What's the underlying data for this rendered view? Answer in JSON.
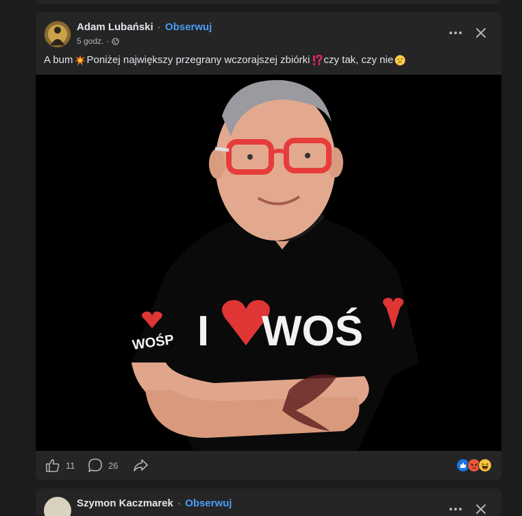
{
  "post": {
    "author": "Adam Lubański",
    "separator": "·",
    "follow_label": "Obserwuj",
    "time": "5 godz.",
    "meta_separator": "·",
    "text_part1": "A bum",
    "text_part2": "Poniżej największy przegrany wczorajszej zbiórki",
    "text_part3": "czy tak, czy nie",
    "emoji_1": "collision-emoji",
    "emoji_2": "exclamation-question-emoji",
    "emoji_3": "thinking-face-emoji",
    "image": {
      "shirt_text_left": "I",
      "shirt_text_right": "WOŚ",
      "sleeve_text": "WOŚP"
    },
    "actions": {
      "like_count": "11",
      "comment_count": "26"
    },
    "reactions": [
      "like",
      "angry",
      "haha"
    ]
  },
  "next_post": {
    "author": "Szymon Kaczmarek",
    "separator": "·",
    "follow_label": "Obserwuj"
  },
  "colors": {
    "background": "#1c1c1d",
    "card": "#252526",
    "accent": "#4a9cf5",
    "text": "#e4e6eb",
    "muted": "#b0b3b8"
  }
}
